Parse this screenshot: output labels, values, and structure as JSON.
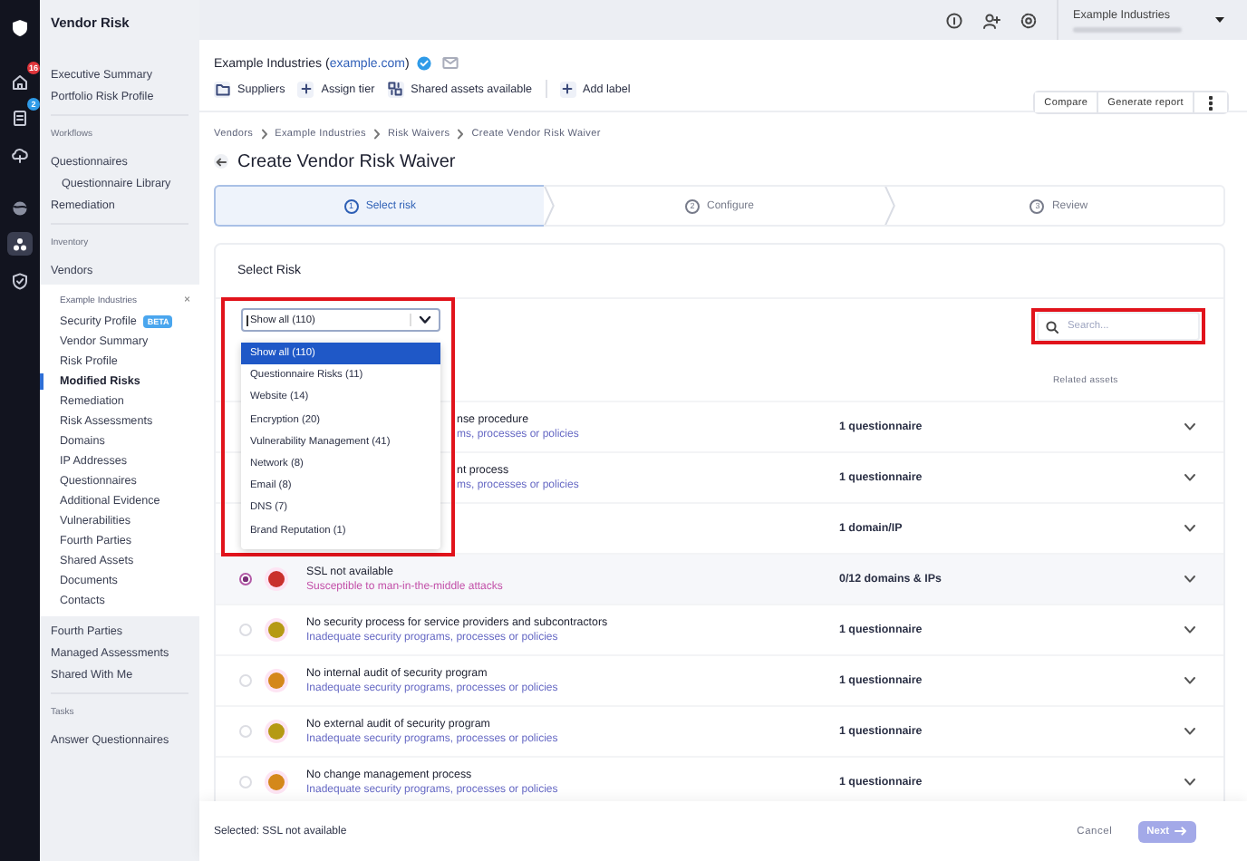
{
  "rail": {
    "items": [
      {
        "kind": "logo",
        "selected": false
      },
      {
        "kind": "home",
        "selected": false,
        "badge": "16",
        "color": "#e0353b"
      },
      {
        "kind": "document",
        "selected": false,
        "badge": "2",
        "color": "#2f9be8"
      },
      {
        "kind": "cloud",
        "selected": false
      },
      {
        "kind": "globe",
        "selected": false
      },
      {
        "kind": "vendors",
        "selected": true
      },
      {
        "kind": "shield",
        "selected": false
      }
    ]
  },
  "topbar": {
    "account": "Example Industries"
  },
  "sidebar": {
    "title": "Vendor Risk",
    "groups": [
      {
        "items": [
          {
            "label": "Executive Summary"
          },
          {
            "label": "Portfolio Risk Profile"
          }
        ]
      },
      {
        "heading": "Workflows",
        "items": [
          {
            "label": "Questionnaires",
            "children": [
              {
                "label": "Questionnaire Library"
              }
            ]
          },
          {
            "label": "Remediation"
          }
        ]
      },
      {
        "heading": "Inventory",
        "items": [
          {
            "label": "Vendors",
            "panel": {
              "title": "Example Industries",
              "close": "×",
              "items": [
                {
                  "label": "Security Profile",
                  "badge": "BETA",
                  "selected": false
                },
                {
                  "label": "Vendor Summary",
                  "selected": false
                },
                {
                  "label": "Risk Profile",
                  "selected": false
                },
                {
                  "label": "Modified Risks",
                  "selected": true
                },
                {
                  "label": "Remediation",
                  "selected": false
                },
                {
                  "label": "Risk Assessments",
                  "selected": false
                },
                {
                  "label": "Domains",
                  "selected": false
                },
                {
                  "label": "IP Addresses",
                  "selected": false
                },
                {
                  "label": "Questionnaires",
                  "selected": false
                },
                {
                  "label": "Additional Evidence",
                  "selected": false
                },
                {
                  "label": "Vulnerabilities",
                  "selected": false
                },
                {
                  "label": "Fourth Parties",
                  "selected": false
                },
                {
                  "label": "Shared Assets",
                  "selected": false
                },
                {
                  "label": "Documents",
                  "selected": false
                },
                {
                  "label": "Contacts",
                  "selected": false
                }
              ]
            }
          },
          {
            "label": "Fourth Parties"
          },
          {
            "label": "Managed Assessments"
          },
          {
            "label": "Shared With Me"
          }
        ]
      },
      {
        "heading": "Tasks",
        "items": [
          {
            "label": "Answer Questionnaires"
          }
        ]
      }
    ]
  },
  "vendor": {
    "name": "Example Industries (",
    "domain": "example.com",
    "name_end": ")",
    "verified": true,
    "tags": [
      {
        "kind": "folder",
        "label": "Suppliers"
      },
      {
        "kind": "add",
        "label": "Assign tier"
      },
      {
        "kind": "shared",
        "label": "Shared assets available"
      },
      {
        "kind": "divider"
      },
      {
        "kind": "add",
        "label": "Add label"
      }
    ],
    "actions": [
      "Compare",
      "Generate report"
    ]
  },
  "breadcrumb": [
    "Vendors",
    "Example Industries",
    "Risk Waivers",
    "Create Vendor Risk Waiver"
  ],
  "title": "Create Vendor Risk Waiver",
  "steps": [
    {
      "number": "1",
      "label": "Select risk",
      "selected": true
    },
    {
      "number": "2",
      "label": "Configure",
      "selected": false
    },
    {
      "number": "3",
      "label": "Review",
      "selected": false
    }
  ],
  "card": {
    "title": "Select Risk",
    "filter": {
      "value": "Show all (110)",
      "expanded": true,
      "highlighted": true,
      "options": [
        {
          "label": "Show all (110)",
          "selected": true
        },
        {
          "label": "Questionnaire Risks (11)",
          "selected": false
        },
        {
          "label": "Website (14)",
          "selected": false
        },
        {
          "label": "Encryption (20)",
          "selected": false
        },
        {
          "label": "Vulnerability Management (41)",
          "selected": false
        },
        {
          "label": "Network (8)",
          "selected": false
        },
        {
          "label": "Email (8)",
          "selected": false
        },
        {
          "label": "DNS (7)",
          "selected": false
        },
        {
          "label": "Brand Reputation (1)",
          "selected": false
        }
      ]
    },
    "search": {
      "placeholder": "Search...",
      "highlighted": true
    },
    "column": "Related assets",
    "rows": [
      {
        "kind": "covered",
        "title": "nse procedure",
        "subtitle": "ms, processes or policies",
        "assets": "1 questionnaire"
      },
      {
        "kind": "covered",
        "title": "nt process",
        "subtitle": "ms, processes or policies",
        "assets": "1 questionnaire"
      },
      {
        "kind": "covered",
        "assets": "1 domain/IP"
      },
      {
        "kind": "full",
        "selected": true,
        "color": "#c9302c",
        "title": "SSL not available",
        "subtitle": "Susceptible to man-in-the-middle attacks",
        "assets": "0/12 domains & IPs"
      },
      {
        "kind": "full",
        "selected": false,
        "color": "#b59a14",
        "title": "No security process for service providers and subcontractors",
        "subtitle": "Inadequate security programs, processes or policies",
        "assets": "1 questionnaire"
      },
      {
        "kind": "full",
        "selected": false,
        "color": "#d4881a",
        "title": "No internal audit of security program",
        "subtitle": "Inadequate security programs, processes or policies",
        "assets": "1 questionnaire"
      },
      {
        "kind": "full",
        "selected": false,
        "color": "#b59a14",
        "title": "No external audit of security program",
        "subtitle": "Inadequate security programs, processes or policies",
        "assets": "1 questionnaire"
      },
      {
        "kind": "full",
        "selected": false,
        "color": "#d4881a",
        "title": "No change management process",
        "subtitle": "Inadequate security programs, processes or policies",
        "assets": "1 questionnaire"
      }
    ]
  },
  "footer": {
    "selection": "Selected: SSL not available",
    "cancel": "Cancel",
    "next": {
      "label": "Next",
      "disabled": true
    }
  }
}
